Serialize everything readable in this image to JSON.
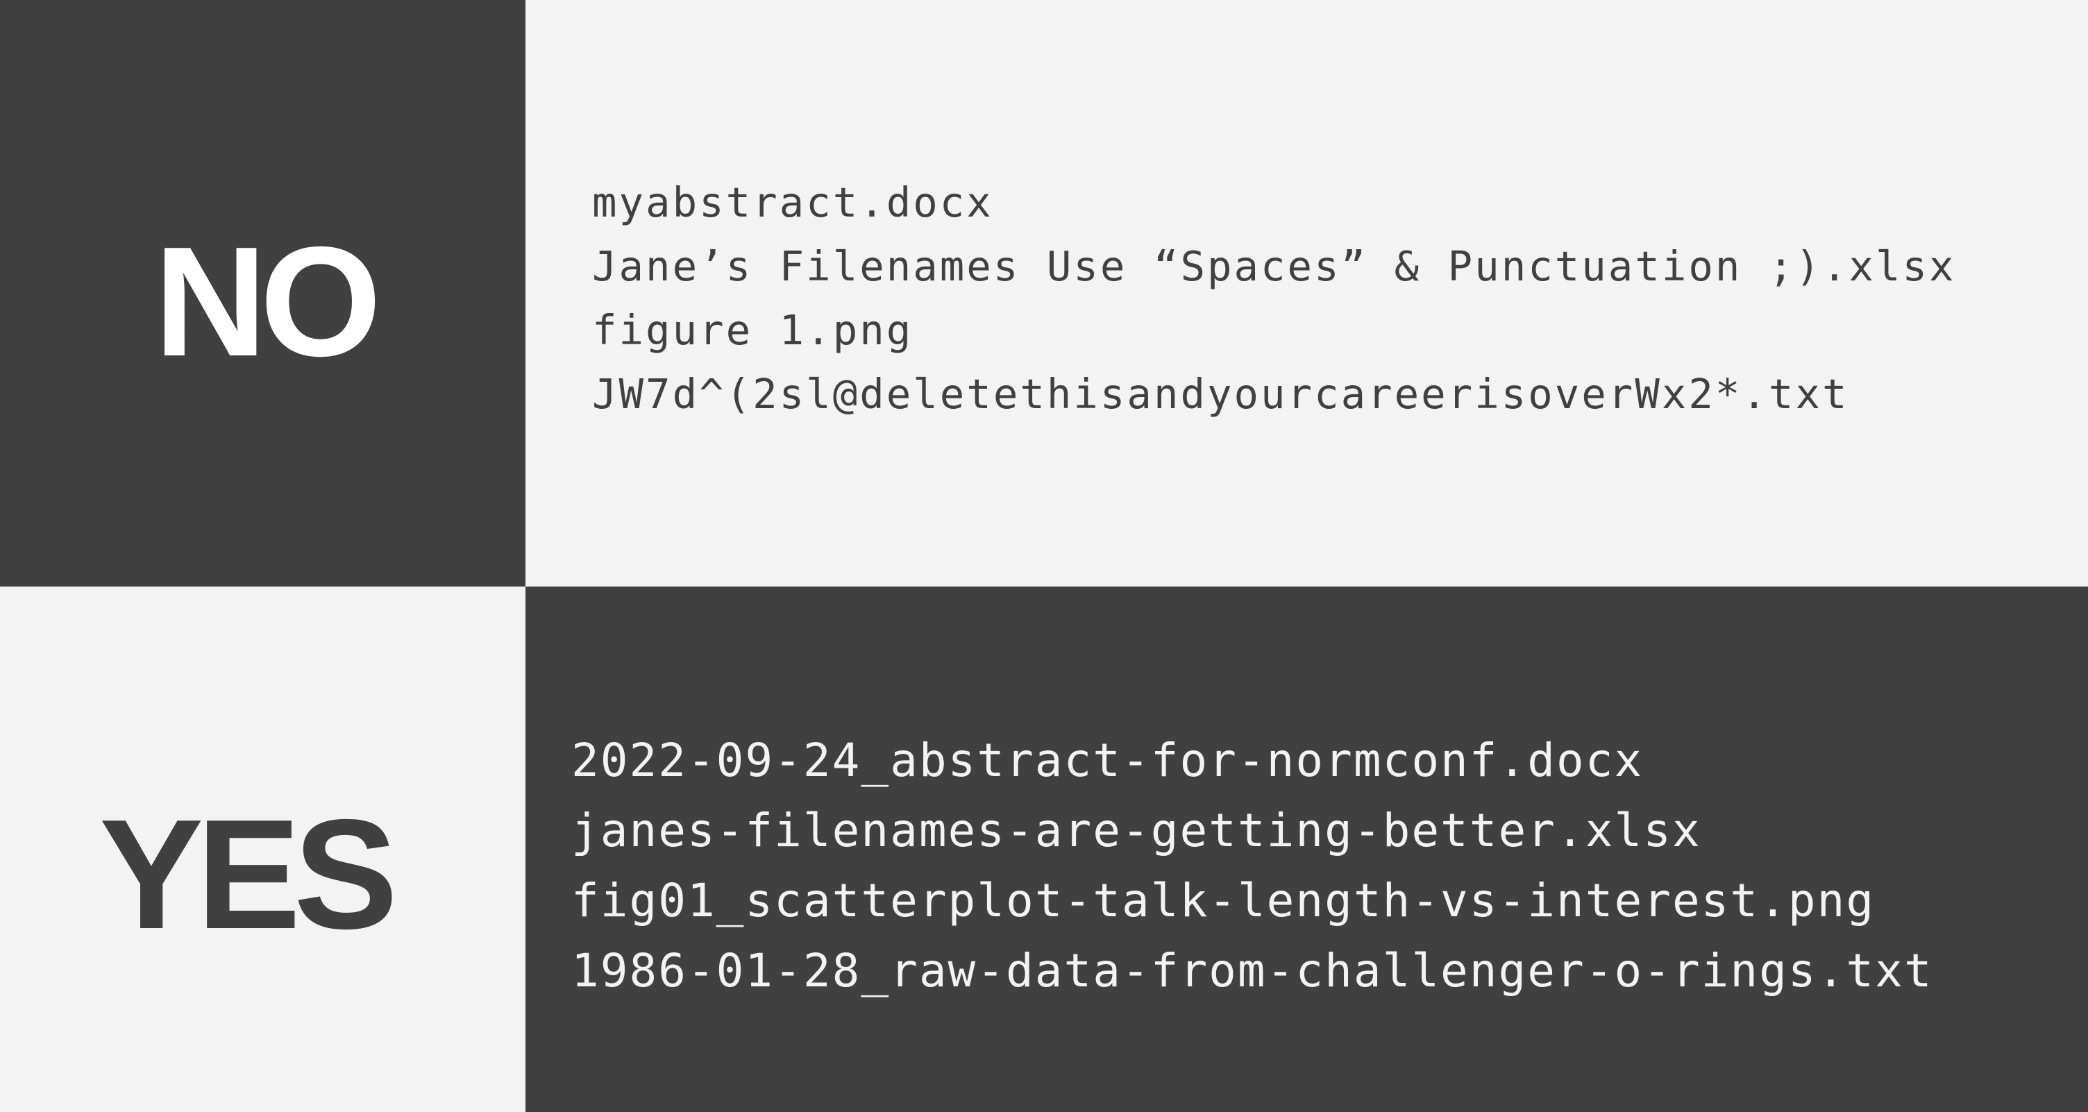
{
  "no_section": {
    "label": "NO",
    "files": [
      "myabstract.docx",
      "Jane’s Filenames Use “Spaces” & Punctuation ;).xlsx",
      "figure 1.png",
      "JW7d^(2sl@deletethisandyourcareerisoverWx2*.txt"
    ]
  },
  "yes_section": {
    "label": "YES",
    "files": [
      "2022-09-24_abstract-for-normconf.docx",
      "janes-filenames-are-getting-better.xlsx",
      "fig01_scatterplot-talk-length-vs-interest.png",
      "1986-01-28_raw-data-from-challenger-o-rings.txt"
    ]
  },
  "colors": {
    "dark": "#404040",
    "light": "#f3f3f3",
    "white": "#ffffff"
  }
}
